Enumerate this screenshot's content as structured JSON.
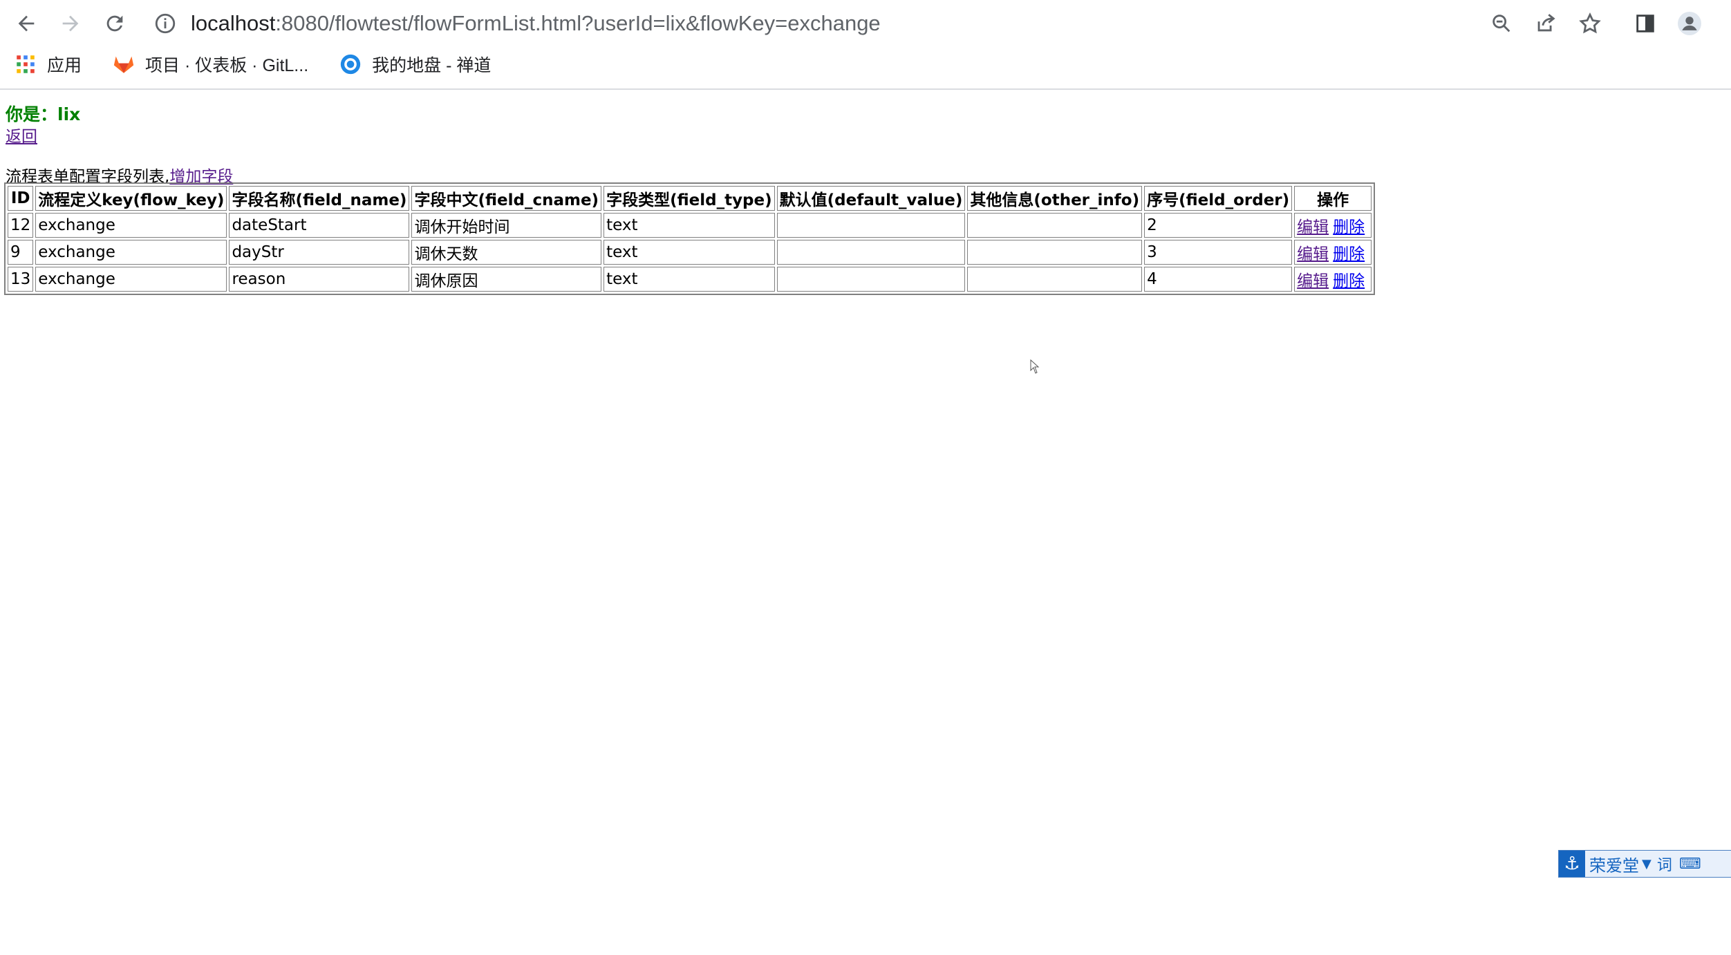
{
  "browser": {
    "url_host": "localhost",
    "url_path": ":8080/flowtest/flowFormList.html?userId=lix&flowKey=exchange",
    "bookmarks": [
      {
        "label": "应用",
        "icon": "apps-grid-icon"
      },
      {
        "label": "项目 · 仪表板 · GitL...",
        "icon": "gitlab-icon"
      },
      {
        "label": "我的地盘 - 禅道",
        "icon": "zentao-icon"
      }
    ]
  },
  "page": {
    "user_line": "你是：lix",
    "back_link": "返回",
    "caption_text": "流程表单配置字段列表,",
    "add_field_link": "增加字段"
  },
  "table": {
    "headers": [
      "ID",
      "流程定义key(flow_key)",
      "字段名称(field_name)",
      "字段中文(field_cname)",
      "字段类型(field_type)",
      "默认值(default_value)",
      "其他信息(other_info)",
      "序号(field_order)",
      "操作"
    ],
    "rows": [
      {
        "id": "12",
        "flow_key": "exchange",
        "field_name": "dateStart",
        "field_cname": "调休开始时间",
        "field_type": "text",
        "default_value": "",
        "other_info": "",
        "field_order": "2"
      },
      {
        "id": "9",
        "flow_key": "exchange",
        "field_name": "dayStr",
        "field_cname": "调休天数",
        "field_type": "text",
        "default_value": "",
        "other_info": "",
        "field_order": "3"
      },
      {
        "id": "13",
        "flow_key": "exchange",
        "field_name": "reason",
        "field_cname": "调休原因",
        "field_type": "text",
        "default_value": "",
        "other_info": "",
        "field_order": "4"
      }
    ],
    "edit_label": "编辑",
    "delete_label": "删除"
  },
  "ime": {
    "label": "荣爱堂",
    "mini_1": "词"
  }
}
